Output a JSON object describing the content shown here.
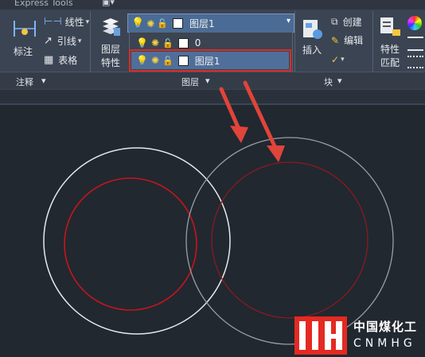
{
  "ribbon": {
    "tab_partial": "Express Tools",
    "annotation": {
      "dimension_label": "标注",
      "linear_label": "线性",
      "leader_label": "引线",
      "table_label": "表格",
      "panel_title": "注释"
    },
    "layers": {
      "properties_label": "图层\n特性",
      "properties_line1": "图层",
      "properties_line2": "特性",
      "current_layer": "图层1",
      "panel_title": "图层",
      "dropdown_items": [
        {
          "name": "0",
          "selected": false
        },
        {
          "name": "图层1",
          "selected": true
        }
      ]
    },
    "block": {
      "insert_label": "插入",
      "create_label": "创建",
      "edit_label": "编辑",
      "panel_title": "块"
    },
    "properties": {
      "match_line1": "特性",
      "match_line2": "匹配"
    }
  },
  "watermark": {
    "logo_text": "中国煤化工",
    "logo_sub": "CNMHG"
  },
  "colors": {
    "canvas_bg": "#212830",
    "ribbon_bg": "#3b4452",
    "highlight_red": "#e02a22",
    "arrow_red": "#e0443a",
    "circle_white": "#e8e8e8",
    "circle_gray": "#9a9ea4",
    "circle_red": "#c8141a",
    "circle_darkred": "#8a1a1e"
  }
}
